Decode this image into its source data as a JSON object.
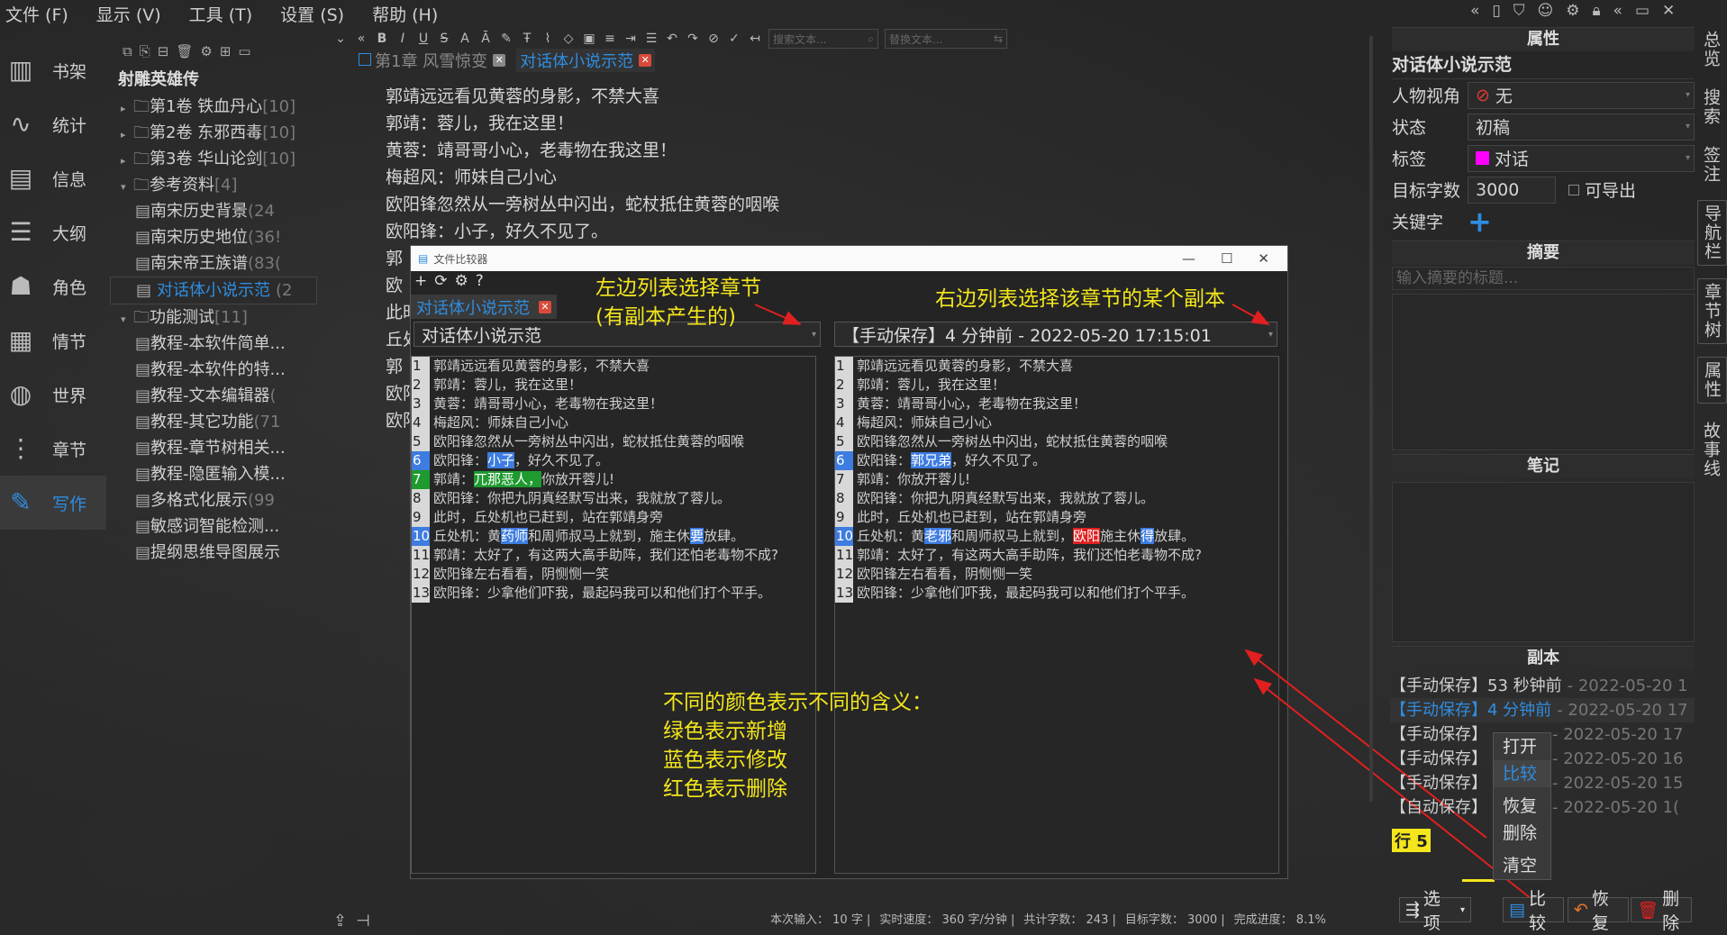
{
  "menu": [
    "文件 (F)",
    "显示 (V)",
    "工具 (T)",
    "设置 (S)",
    "帮助 (H)"
  ],
  "toolbar": {
    "search_placeholder": "搜索文本...",
    "replace_placeholder": "替换文本..."
  },
  "nav": [
    {
      "label": "书架",
      "icon": "bookshelf-icon",
      "glyph": "▥"
    },
    {
      "label": "统计",
      "icon": "chart-icon",
      "glyph": "∿"
    },
    {
      "label": "信息",
      "icon": "calendar-icon",
      "glyph": "▤"
    },
    {
      "label": "大纲",
      "icon": "outline-icon",
      "glyph": "☰"
    },
    {
      "label": "角色",
      "icon": "people-icon",
      "glyph": "☗"
    },
    {
      "label": "情节",
      "icon": "grid-icon",
      "glyph": "▦"
    },
    {
      "label": "世界",
      "icon": "globe-icon",
      "glyph": "◍"
    },
    {
      "label": "章节",
      "icon": "chapter-tree-icon",
      "glyph": "⋮"
    },
    {
      "label": "写作",
      "icon": "pen-icon",
      "glyph": "✎"
    }
  ],
  "tree": {
    "book": "射雕英雄传",
    "rows": [
      {
        "tri": "▸",
        "folder": true,
        "text": "第1卷 铁血丹心",
        "count": "[10]",
        "indent": 0
      },
      {
        "tri": "▸",
        "folder": true,
        "text": "第2卷 东邪西毒",
        "count": "[10]",
        "indent": 0
      },
      {
        "tri": "▸",
        "folder": true,
        "text": "第3卷 华山论剑",
        "count": "[10]",
        "indent": 0
      },
      {
        "tri": "▾",
        "folder": true,
        "text": "参考资料",
        "count": "[4]",
        "indent": 0
      },
      {
        "tri": "",
        "folder": false,
        "text": "南宋历史背景",
        "count": "(24",
        "indent": 1
      },
      {
        "tri": "",
        "folder": false,
        "text": "南宋历史地位",
        "count": "(36!",
        "indent": 1
      },
      {
        "tri": "",
        "folder": false,
        "text": "南宋帝王族谱",
        "count": "(83(",
        "indent": 1
      },
      {
        "tri": "",
        "folder": false,
        "text": "对话体小说示范",
        "count": "(2",
        "indent": 1,
        "selected": true
      },
      {
        "tri": "▾",
        "folder": true,
        "text": "功能测试",
        "count": "[11]",
        "indent": 0
      },
      {
        "tri": "",
        "folder": false,
        "text": "教程-本软件简单...",
        "count": "",
        "indent": 1
      },
      {
        "tri": "",
        "folder": false,
        "text": "教程-本软件的特...",
        "count": "",
        "indent": 1
      },
      {
        "tri": "",
        "folder": false,
        "text": "教程-文本编辑器",
        "count": "(",
        "indent": 1
      },
      {
        "tri": "",
        "folder": false,
        "text": "教程-其它功能",
        "count": "(71",
        "indent": 1
      },
      {
        "tri": "",
        "folder": false,
        "text": "教程-章节树相关...",
        "count": "",
        "indent": 1
      },
      {
        "tri": "",
        "folder": false,
        "text": "教程-隐匿输入模...",
        "count": "",
        "indent": 1
      },
      {
        "tri": "",
        "folder": false,
        "text": "多格式化展示",
        "count": "(99",
        "indent": 1
      },
      {
        "tri": "",
        "folder": false,
        "text": "敏感词智能检测...",
        "count": "",
        "indent": 1
      },
      {
        "tri": "",
        "folder": false,
        "text": "提纲思维导图展示",
        "count": "",
        "indent": 1
      }
    ]
  },
  "editor_tabs": [
    {
      "label": "第1章 风雪惊变",
      "active": false
    },
    {
      "label": "对话体小说示范",
      "active": true
    }
  ],
  "editor_lines": [
    "郭靖远远看见黄蓉的身影，不禁大喜",
    "郭靖：蓉儿，我在这里！",
    "黄蓉：靖哥哥小心，老毒物在我这里！",
    "梅超风：师妹自己小心",
    "欧阳锋忽然从一旁树丛中闪出，蛇杖抵住黄蓉的咽喉",
    "欧阳锋：小子，好久不见了。",
    "郭",
    "欧",
    "此时",
    "丘处",
    "郭",
    "欧阳",
    "欧阳"
  ],
  "dialog": {
    "title": "文件比较器",
    "tab": "对话体小说示范",
    "left_select": "对话体小说示范",
    "right_select": "【手动保存】4 分钟前 - 2022-05-20 17:15:01",
    "left_lines": [
      [
        {
          "t": "郭靖远远看见黄蓉的身影，不禁大喜"
        }
      ],
      [
        {
          "t": "郭靖：蓉儿，我在这里！"
        }
      ],
      [
        {
          "t": "黄蓉：靖哥哥小心，老毒物在我这里！"
        }
      ],
      [
        {
          "t": "梅超风：师妹自己小心"
        }
      ],
      [
        {
          "t": "欧阳锋忽然从一旁树丛中闪出，蛇杖抵住黄蓉的咽喉"
        }
      ],
      [
        {
          "t": "欧阳锋："
        },
        {
          "t": "小子",
          "h": "b"
        },
        {
          "t": "，好久不见了。"
        }
      ],
      [
        {
          "t": "郭靖："
        },
        {
          "t": "兀那恶人，",
          "h": "g"
        },
        {
          "t": "你放开蓉儿!"
        }
      ],
      [
        {
          "t": "欧阳锋：你把九阴真经默写出来，我就放了蓉儿。"
        }
      ],
      [
        {
          "t": "此时，丘处机也已赶到，站在郭靖身旁"
        }
      ],
      [
        {
          "t": "丘处机：黄"
        },
        {
          "t": "药师",
          "h": "b"
        },
        {
          "t": "和周师叔马上就到，施主休"
        },
        {
          "t": "要",
          "h": "b"
        },
        {
          "t": "放肆。"
        }
      ],
      [
        {
          "t": "郭靖：太好了，有这两大高手助阵，我们还怕老毒物不成?"
        }
      ],
      [
        {
          "t": "欧阳锋左右看看，阴恻恻一笑"
        }
      ],
      [
        {
          "t": "欧阳锋：少拿他们吓我，最起码我可以和他们打个平手。"
        }
      ]
    ],
    "left_marks": [
      "",
      "",
      "",
      "",
      "",
      "b",
      "g",
      "",
      "",
      "b",
      "",
      "",
      ""
    ],
    "right_lines": [
      [
        {
          "t": "郭靖远远看见黄蓉的身影，不禁大喜"
        }
      ],
      [
        {
          "t": "郭靖：蓉儿，我在这里！"
        }
      ],
      [
        {
          "t": "黄蓉：靖哥哥小心，老毒物在我这里！"
        }
      ],
      [
        {
          "t": "梅超风：师妹自己小心"
        }
      ],
      [
        {
          "t": "欧阳锋忽然从一旁树丛中闪出，蛇杖抵住黄蓉的咽喉"
        }
      ],
      [
        {
          "t": "欧阳锋："
        },
        {
          "t": "郭兄弟",
          "h": "b"
        },
        {
          "t": "，好久不见了。"
        }
      ],
      [
        {
          "t": "郭靖：你放开蓉儿!"
        }
      ],
      [
        {
          "t": "欧阳锋：你把九阴真经默写出来，我就放了蓉儿。"
        }
      ],
      [
        {
          "t": "此时，丘处机也已赶到，站在郭靖身旁"
        }
      ],
      [
        {
          "t": "丘处机：黄"
        },
        {
          "t": "老邪",
          "h": "b"
        },
        {
          "t": "和周师叔马上就到，"
        },
        {
          "t": "欧阳",
          "h": "r"
        },
        {
          "t": "施主休"
        },
        {
          "t": "得",
          "h": "b"
        },
        {
          "t": "放肆。"
        }
      ],
      [
        {
          "t": "郭靖：太好了，有这两大高手助阵，我们还怕老毒物不成?"
        }
      ],
      [
        {
          "t": "欧阳锋左右看看，阴恻恻一笑"
        }
      ],
      [
        {
          "t": "欧阳锋：少拿他们吓我，最起码我可以和他们打个平手。"
        }
      ]
    ],
    "right_marks": [
      "",
      "",
      "",
      "",
      "",
      "b",
      "",
      "",
      "",
      "b",
      "",
      "",
      ""
    ]
  },
  "annotations": {
    "left_1": "左边列表选择章节",
    "left_2": "(有副本产生的)",
    "right_1": "右边列表选择该章节的某个副本",
    "legend_1": "不同的颜色表示不同的含义：",
    "legend_2": "绿色表示新增",
    "legend_3": "蓝色表示修改",
    "legend_4": "红色表示删除"
  },
  "props": {
    "header": "属性",
    "chapter": "对话体小说示范",
    "pov_label": "人物视角",
    "pov_value": "无",
    "status_label": "状态",
    "status_value": "初稿",
    "tag_label": "标签",
    "tag_value": "对话",
    "target_label": "目标字数",
    "target_value": "3000",
    "exportable": "可导出",
    "keyword_label": "关键字",
    "summary_header": "摘要",
    "summary_placeholder": "输入摘要的标题...",
    "notes_header": "笔记",
    "versions_header": "副本",
    "row_label": "行 5"
  },
  "versions": [
    {
      "type": "【手动保存】",
      "time": "53 秒钟前",
      "date": "- 2022-05-20 1"
    },
    {
      "type": "【手动保存】",
      "time": "4 分钟前",
      "date": "- 2022-05-20 17",
      "selected": true
    },
    {
      "type": "【手动保存】",
      "time": "",
      "date": "- 2022-05-20 17"
    },
    {
      "type": "【手动保存】",
      "time": "",
      "date": "- 2022-05-20 16"
    },
    {
      "type": "【手动保存】",
      "time": "",
      "date": "- 2022-05-20 15"
    },
    {
      "type": "【自动保存】",
      "time": "",
      "date": "- 2022-05-20 1("
    }
  ],
  "context_menu": [
    "打开",
    "比较",
    "恢复",
    "删除",
    "清空"
  ],
  "bottom_buttons": {
    "options": "选项",
    "compare": "比较",
    "restore": "恢复",
    "delete": "删除"
  },
  "vtabs": [
    "总览",
    "搜索",
    "签注",
    "导航栏",
    "章节树",
    "属性",
    "故事线"
  ],
  "status": {
    "input_label": "本次输入：",
    "input_value": "10",
    "input_unit": "字",
    "speed_label": "实时速度：",
    "speed_value": "360 字/分钟",
    "total_label": "共计字数：",
    "total_value": "243",
    "target_label": "目标字数：",
    "target_value": "3000",
    "progress_label": "完成进度：",
    "progress_value": "8.1%"
  },
  "colors": {
    "accent": "#2f8de0",
    "added": "#1e9a2e",
    "modified": "#3d7ce0",
    "deleted": "#e02020",
    "note": "#f3e61d",
    "tag": "#ff00ff"
  }
}
